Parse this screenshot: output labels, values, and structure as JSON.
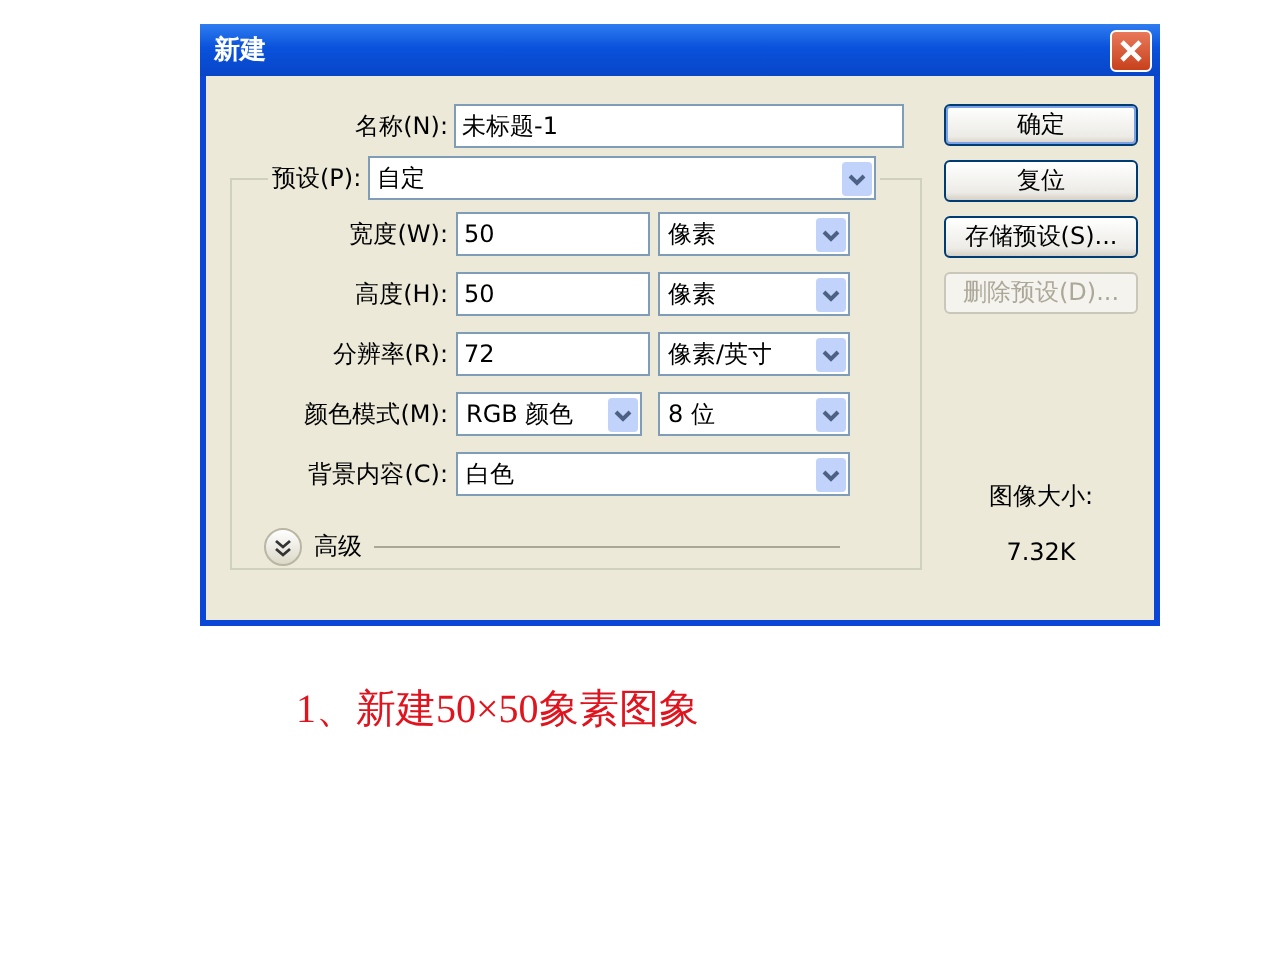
{
  "window": {
    "title": "新建"
  },
  "name_field": {
    "label": "名称(N):",
    "value": "未标题-1"
  },
  "preset": {
    "label": "预设(P):",
    "value": "自定"
  },
  "rows": [
    {
      "kind": "input-select",
      "label": "宽度(W):",
      "value": "50",
      "unit": "像素"
    },
    {
      "kind": "input-select",
      "label": "高度(H):",
      "value": "50",
      "unit": "像素"
    },
    {
      "kind": "input-select",
      "label": "分辨率(R):",
      "value": "72",
      "unit": "像素/英寸"
    },
    {
      "kind": "select-select",
      "label": "颜色模式(M):",
      "value": "RGB 颜色",
      "unit": "8 位"
    },
    {
      "kind": "wide-select",
      "label": "背景内容(C):",
      "value": "白色"
    }
  ],
  "advanced": {
    "label": "高级",
    "expanded": false
  },
  "buttons": [
    {
      "label": "确定",
      "default": true,
      "disabled": false
    },
    {
      "label": "复位",
      "default": false,
      "disabled": false
    },
    {
      "label": "存储预设(S)...",
      "default": false,
      "disabled": false
    },
    {
      "label": "删除预设(D)...",
      "default": false,
      "disabled": true
    }
  ],
  "image_size": {
    "label": "图像大小:",
    "value": "7.32K"
  },
  "caption": "1、新建50×50象素图象"
}
